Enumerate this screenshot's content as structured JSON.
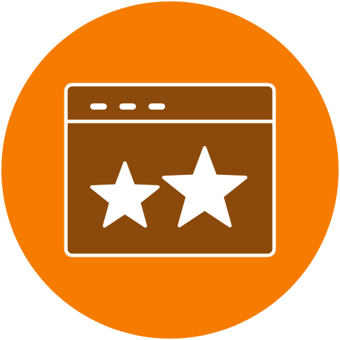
{
  "icon": {
    "name": "browser-window-rating-icon",
    "background_color": "#F57C00",
    "window_fill_color": "#8B4A0B",
    "line_color": "#FFFFFF",
    "window_dots_count": 3,
    "star_rating_shown": 2
  }
}
